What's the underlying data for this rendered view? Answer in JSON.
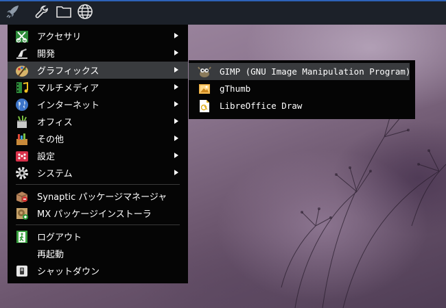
{
  "panel": {
    "buttons": [
      {
        "name": "start-menu",
        "icon": "rocket-icon"
      },
      {
        "name": "settings",
        "icon": "wrench-icon"
      },
      {
        "name": "file-manager",
        "icon": "folder-icon"
      },
      {
        "name": "web-browser",
        "icon": "globe-icon"
      }
    ]
  },
  "menu": {
    "categories": [
      {
        "label": "アクセサリ",
        "icon": "accessories-icon",
        "has_submenu": true
      },
      {
        "label": "開発",
        "icon": "development-icon",
        "has_submenu": true
      },
      {
        "label": "グラフィックス",
        "icon": "graphics-icon",
        "has_submenu": true,
        "selected": true
      },
      {
        "label": "マルチメディア",
        "icon": "multimedia-icon",
        "has_submenu": true
      },
      {
        "label": "インターネット",
        "icon": "internet-icon",
        "has_submenu": true
      },
      {
        "label": "オフィス",
        "icon": "office-icon",
        "has_submenu": true
      },
      {
        "label": "その他",
        "icon": "other-icon",
        "has_submenu": true
      },
      {
        "label": "設定",
        "icon": "settings-icon",
        "has_submenu": true
      },
      {
        "label": "システム",
        "icon": "system-icon",
        "has_submenu": true
      }
    ],
    "apps": [
      {
        "label": "Synaptic パッケージマネージャ",
        "icon": "synaptic-icon"
      },
      {
        "label": "MX パッケージインストーラ",
        "icon": "mx-installer-icon"
      }
    ],
    "session": [
      {
        "label": "ログアウト",
        "icon": "logout-icon"
      },
      {
        "label": "再起動",
        "icon": ""
      },
      {
        "label": "シャットダウン",
        "icon": "shutdown-icon"
      }
    ]
  },
  "submenu": {
    "items": [
      {
        "label": "GIMP (GNU Image Manipulation Program)",
        "icon": "gimp-icon",
        "selected": true
      },
      {
        "label": "gThumb",
        "icon": "gthumb-icon"
      },
      {
        "label": "LibreOffice Draw",
        "icon": "libreoffice-draw-icon"
      }
    ]
  },
  "colors": {
    "panel_bg": "#1c2129",
    "panel_accent": "#2d63b9",
    "menu_bg": "#050505",
    "highlight": "#393b3e"
  }
}
